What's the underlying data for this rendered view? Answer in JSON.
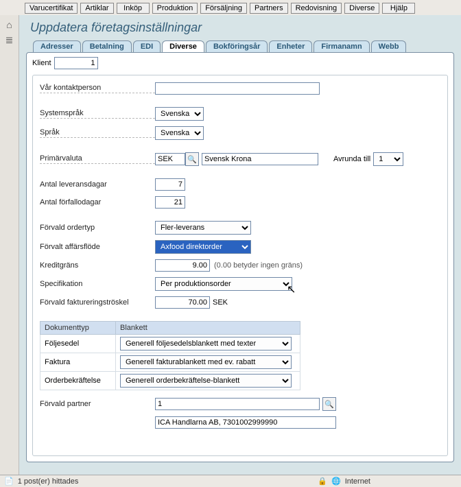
{
  "top_menu": [
    "Varucertifikat",
    "Artiklar",
    "Inköp",
    "Produktion",
    "Försäljning",
    "Partners",
    "Redovisning",
    "Diverse",
    "Hjälp"
  ],
  "page_title": "Uppdatera företagsinställningar",
  "tabs": [
    "Adresser",
    "Betalning",
    "EDI",
    "Diverse",
    "Bokföringsår",
    "Enheter",
    "Firmanamn",
    "Webb"
  ],
  "active_tab": "Diverse",
  "klient_label": "Klient",
  "klient_value": "1",
  "labels": {
    "contact": "Vår kontaktperson",
    "systemlang": "Systemspråk",
    "lang": "Språk",
    "primcur": "Primärvaluta",
    "roundto": "Avrunda till",
    "deliverydays": "Antal leveransdagar",
    "duedays": "Antal förfallodagar",
    "ordertype": "Förvald ordertyp",
    "bizflow": "Förvalt affärsflöde",
    "creditlimit": "Kreditgräns",
    "credit_hint": "(0.00 betyder ingen gräns)",
    "specification": "Specifikation",
    "invthreshold": "Förvald faktureringströskel",
    "curunit": "SEK",
    "doc_col1": "Dokumenttyp",
    "doc_col2": "Blankett",
    "doc_row1": "Följesedel",
    "doc_row2": "Faktura",
    "doc_row3": "Orderbekräftelse",
    "defpartner": "Förvald partner"
  },
  "values": {
    "contact": "",
    "systemlang": "Svenska",
    "lang": "Svenska",
    "primcur_code": "SEK",
    "primcur_name": "Svensk Krona",
    "roundto": "1",
    "deliverydays": "7",
    "duedays": "21",
    "ordertype": "Fler-leverans",
    "bizflow": "Axfood direktorder",
    "creditlimit": "9.00",
    "specification": "Per produktionsorder",
    "invthreshold": "70.00",
    "doc_row1_val": "Generell följesedelsblankett med texter",
    "doc_row2_val": "Generell fakturablankett med ev. rabatt",
    "doc_row3_val": "Generell orderbekräftelse-blankett",
    "defpartner_id": "1",
    "defpartner_name": "ICA Handlarna AB, 7301002999990"
  },
  "statusbar": {
    "left": "1 post(er) hittades",
    "zone": "Internet"
  }
}
